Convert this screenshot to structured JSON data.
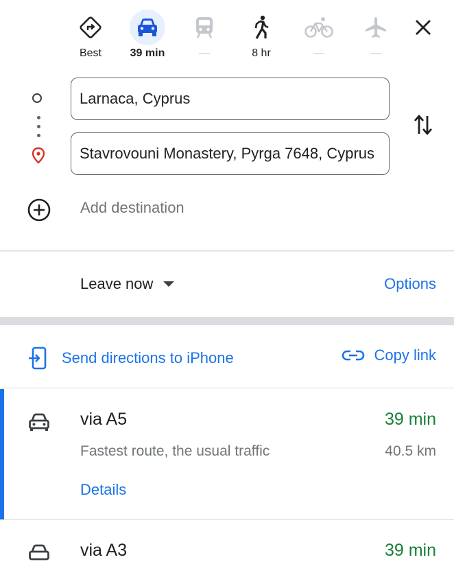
{
  "modes": [
    {
      "name": "Best",
      "label": "Best",
      "icon": "route-icon",
      "selected": false
    },
    {
      "name": "Driving",
      "label": "39 min",
      "icon": "car-icon",
      "selected": true
    },
    {
      "name": "Transit",
      "label": "—",
      "icon": "train-icon",
      "selected": false
    },
    {
      "name": "Walking",
      "label": "8 hr",
      "icon": "walk-icon",
      "selected": false
    },
    {
      "name": "Cycling",
      "label": "—",
      "icon": "bike-icon",
      "selected": false
    },
    {
      "name": "Flights",
      "label": "—",
      "icon": "plane-icon",
      "selected": false
    }
  ],
  "inputs": {
    "origin": "Larnaca, Cyprus",
    "destination": "Stavrovouni Monastery, Pyrga 7648, Cyprus",
    "add_destination": "Add destination"
  },
  "departure": {
    "label": "Leave now",
    "options_label": "Options"
  },
  "share": {
    "send_label": "Send directions to iPhone",
    "copy_label": "Copy link"
  },
  "routes": [
    {
      "name": "via A5",
      "duration": "39 min",
      "description": "Fastest route, the usual traffic",
      "distance": "40.5 km",
      "details_label": "Details"
    },
    {
      "name": "via A3",
      "duration": "39 min"
    }
  ],
  "colors": {
    "accent": "#1a73e8",
    "selected_mode_bg": "#e8f0fe",
    "duration_green": "#188038",
    "secondary_text": "#70757a",
    "destination_pin": "#d93025",
    "disabled_icon": "#c4c7cb"
  }
}
